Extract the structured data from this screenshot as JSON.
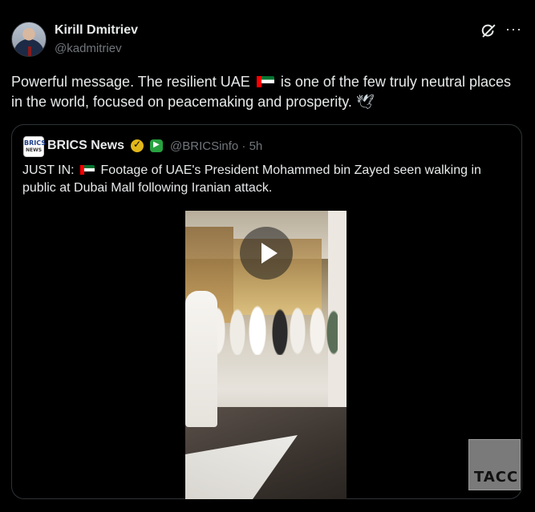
{
  "post": {
    "author_name": "Kirill Dmitriev",
    "author_handle": "@kadmitriev",
    "text_part1": "Powerful message. The resilient UAE",
    "text_part2": "is one of the few truly neutral places in the world, focused on peacemaking and prosperity.",
    "dove": "🕊",
    "more_label": "···"
  },
  "quote": {
    "avatar_text_top": "BRICS",
    "avatar_text_bottom": "NEWS",
    "author_name": "BRICS News",
    "author_handle": "@BRICSinfo · 5h",
    "text_part1": "JUST IN:",
    "text_part2": "Footage of UAE's President Mohammed bin Zayed seen walking in public at Dubai Mall following Iranian attack."
  },
  "watermark": {
    "text": "TACC"
  },
  "colors": {
    "background": "#000000",
    "text": "#e7e9ea",
    "secondary_text": "#71767b",
    "border": "#2f3336",
    "gold_badge": "#e2b719",
    "green_badge": "#27a23f"
  },
  "icons": [
    "grok-icon",
    "more-icon",
    "uae-flag-icon",
    "dove-icon",
    "gold-verified-icon",
    "green-affiliate-icon",
    "play-icon"
  ]
}
